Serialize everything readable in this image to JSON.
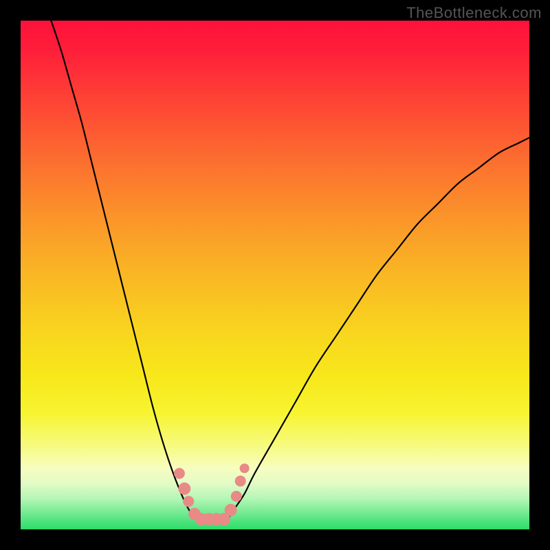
{
  "watermark": "TheBottleneck.com",
  "chart_data": {
    "type": "line",
    "title": "",
    "xlabel": "",
    "ylabel": "",
    "xlim": [
      0,
      100
    ],
    "ylim": [
      0,
      100
    ],
    "series": [
      {
        "name": "left-branch",
        "x": [
          6,
          8,
          10,
          12,
          14,
          16,
          18,
          20,
          22,
          24,
          26,
          28,
          30,
          32,
          33,
          34,
          35
        ],
        "y": [
          100,
          94,
          87,
          80,
          72,
          64,
          56,
          48,
          40,
          32,
          24,
          17,
          11,
          6,
          4,
          2.5,
          2
        ]
      },
      {
        "name": "right-branch",
        "x": [
          40,
          41,
          42,
          44,
          46,
          50,
          54,
          58,
          62,
          66,
          70,
          74,
          78,
          82,
          86,
          90,
          94,
          98,
          100
        ],
        "y": [
          2,
          2.5,
          4,
          7,
          11,
          18,
          25,
          32,
          38,
          44,
          50,
          55,
          60,
          64,
          68,
          71,
          74,
          76,
          77
        ]
      }
    ],
    "floor_segment": {
      "x": [
        35,
        40
      ],
      "y": [
        2,
        2
      ]
    },
    "markers": {
      "name": "pink-beads",
      "color": "#e98a87",
      "radius_seq": [
        {
          "x": 31.2,
          "y": 11.0,
          "r": 8
        },
        {
          "x": 32.2,
          "y": 8.0,
          "r": 9
        },
        {
          "x": 33.0,
          "y": 5.5,
          "r": 8
        },
        {
          "x": 34.2,
          "y": 3.0,
          "r": 9
        },
        {
          "x": 35.5,
          "y": 2.0,
          "r": 9
        },
        {
          "x": 37.0,
          "y": 2.0,
          "r": 9
        },
        {
          "x": 38.5,
          "y": 2.0,
          "r": 9
        },
        {
          "x": 40.0,
          "y": 2.0,
          "r": 9
        },
        {
          "x": 41.3,
          "y": 3.8,
          "r": 9
        },
        {
          "x": 42.4,
          "y": 6.5,
          "r": 8
        },
        {
          "x": 43.2,
          "y": 9.5,
          "r": 8
        },
        {
          "x": 44.0,
          "y": 12.0,
          "r": 7
        }
      ]
    },
    "gradient_stops": [
      {
        "pct": 0,
        "color": "#fe113b"
      },
      {
        "pct": 6,
        "color": "#fe1f3a"
      },
      {
        "pct": 14,
        "color": "#fe3d36"
      },
      {
        "pct": 22,
        "color": "#fd5a32"
      },
      {
        "pct": 30,
        "color": "#fc772e"
      },
      {
        "pct": 38,
        "color": "#fb922a"
      },
      {
        "pct": 46,
        "color": "#faab26"
      },
      {
        "pct": 54,
        "color": "#f9c222"
      },
      {
        "pct": 62,
        "color": "#f8d71e"
      },
      {
        "pct": 70,
        "color": "#f7e81b"
      },
      {
        "pct": 77,
        "color": "#f7f430"
      },
      {
        "pct": 83,
        "color": "#f7fa78"
      },
      {
        "pct": 88,
        "color": "#f7fdc0"
      },
      {
        "pct": 91,
        "color": "#e2fbc6"
      },
      {
        "pct": 94,
        "color": "#b3f6b5"
      },
      {
        "pct": 97,
        "color": "#6ee98f"
      },
      {
        "pct": 100,
        "color": "#2bdd6a"
      }
    ]
  }
}
